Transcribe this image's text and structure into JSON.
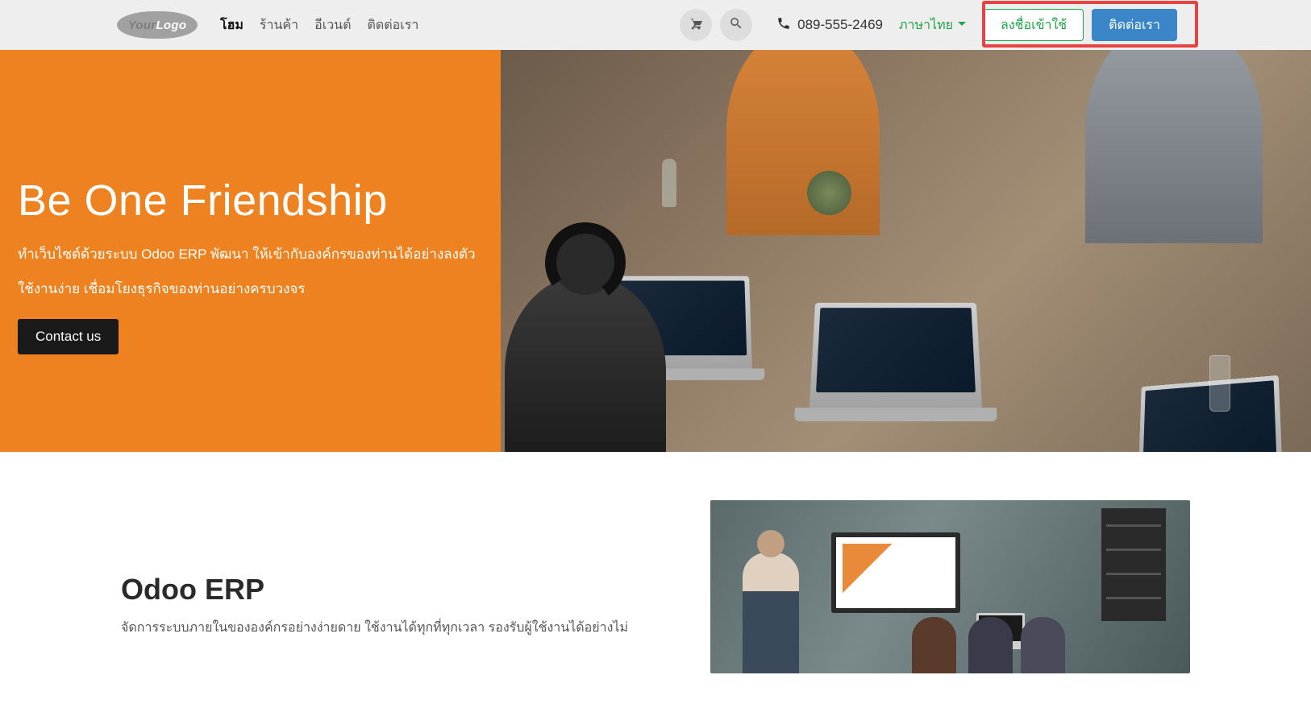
{
  "header": {
    "logo_text_left": "Your",
    "logo_text_right": "Logo",
    "nav": [
      {
        "label": "โฮม",
        "active": true
      },
      {
        "label": "ร้านค้า",
        "active": false
      },
      {
        "label": "อีเวนต์",
        "active": false
      },
      {
        "label": "ติดต่อเรา",
        "active": false
      }
    ],
    "phone": "089-555-2469",
    "language": "ภาษาไทย",
    "signin_label": "ลงชื่อเข้าใช้",
    "contact_label": "ติดต่อเรา"
  },
  "hero": {
    "title": "Be One Friendship",
    "line1": "ทำเว็บไซต์ด้วยระบบ Odoo ERP พัฒนา ให้เข้ากับองค์กรของท่านได้อย่างลงตัว",
    "line2": "ใช้งานง่าย เชื่อมโยงธุรกิจของท่านอย่างครบวงจร",
    "button": "Contact us"
  },
  "section2": {
    "title": "Odoo ERP",
    "desc": "จัดการระบบภายในขององค์กรอย่างง่ายดาย ใช้งานได้ทุกที่ทุกเวลา รองรับผู้ใช้งานได้อย่างไม่"
  },
  "colors": {
    "hero_bg": "#ee8220",
    "accent_green": "#1fa34a",
    "accent_blue": "#3a86c8",
    "highlight_red": "#e74340"
  }
}
